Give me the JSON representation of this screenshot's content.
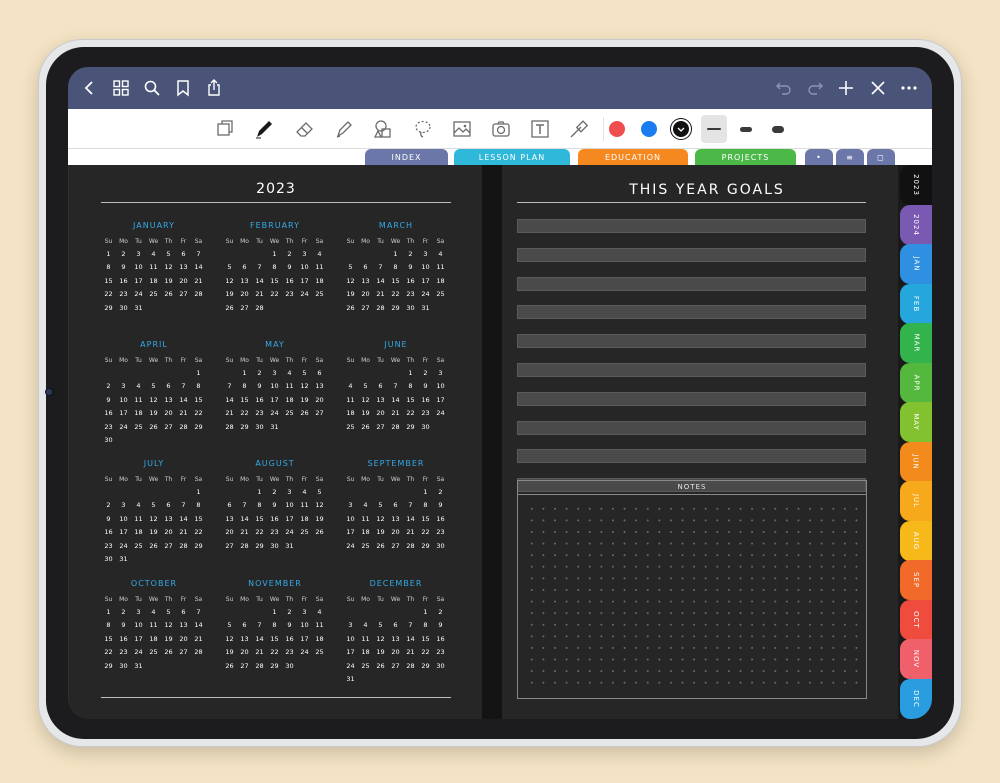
{
  "colors": {
    "background": "#f4e3c4",
    "topbar": "#4a5479",
    "page": "#262626",
    "month_accent": "#35a9e6"
  },
  "topbar": {
    "left_icons": [
      "back-chevron-icon",
      "grid-icon",
      "search-icon",
      "bookmark-icon",
      "share-icon"
    ],
    "right_icons": [
      "undo-icon",
      "redo-icon",
      "plus-icon",
      "close-icon",
      "more-icon"
    ]
  },
  "toolbar": {
    "tools": [
      "page-view-icon",
      "pen-icon",
      "eraser-icon",
      "highlighter-icon",
      "shapes-icon",
      "lasso-icon",
      "image-icon",
      "camera-icon",
      "text-icon",
      "laser-pointer-icon"
    ],
    "pen_colors": [
      "#f04e4e",
      "#1a7cf0",
      "#111111"
    ],
    "selected_color": "#111111",
    "selected_stroke": "thin"
  },
  "section_tabs": [
    {
      "label": "INDEX",
      "color": "#6a77a8"
    },
    {
      "label": "LESSON PLAN",
      "color": "#2fb8d9"
    },
    {
      "label": "EDUCATION",
      "color": "#f5891f"
    },
    {
      "label": "PROJECTS",
      "color": "#4cb848"
    }
  ],
  "mini_tabs": [
    "•",
    "≡",
    "◻"
  ],
  "left_page": {
    "year": "2023",
    "dow": [
      "Su",
      "Mo",
      "Tu",
      "We",
      "Th",
      "Fr",
      "Sa"
    ],
    "months": [
      {
        "name": "JANUARY",
        "start": 0,
        "days": 31
      },
      {
        "name": "FEBRUARY",
        "start": 3,
        "days": 28
      },
      {
        "name": "MARCH",
        "start": 3,
        "days": 31
      },
      {
        "name": "APRIL",
        "start": 6,
        "days": 30
      },
      {
        "name": "MAY",
        "start": 1,
        "days": 31
      },
      {
        "name": "JUNE",
        "start": 4,
        "days": 30
      },
      {
        "name": "JULY",
        "start": 6,
        "days": 31
      },
      {
        "name": "AUGUST",
        "start": 2,
        "days": 31
      },
      {
        "name": "SEPTEMBER",
        "start": 5,
        "days": 30
      },
      {
        "name": "OCTOBER",
        "start": 0,
        "days": 31
      },
      {
        "name": "NOVEMBER",
        "start": 3,
        "days": 30
      },
      {
        "name": "DECEMBER",
        "start": 5,
        "days": 31
      }
    ]
  },
  "right_page": {
    "title": "THIS YEAR GOALS",
    "goal_lines": 10,
    "notes_label": "NOTES"
  },
  "side_tabs": [
    {
      "label": "2023",
      "color": "#111111"
    },
    {
      "label": "2024",
      "color": "#7a59b3"
    },
    {
      "label": "JAN",
      "color": "#2f8fe0"
    },
    {
      "label": "FEB",
      "color": "#25a7de"
    },
    {
      "label": "MAR",
      "color": "#33b34b"
    },
    {
      "label": "APR",
      "color": "#55b83e"
    },
    {
      "label": "MAY",
      "color": "#82c12f"
    },
    {
      "label": "JUN",
      "color": "#f28a1c"
    },
    {
      "label": "JUL",
      "color": "#f6a91a"
    },
    {
      "label": "AUG",
      "color": "#f7b81a"
    },
    {
      "label": "SEP",
      "color": "#f26a2a"
    },
    {
      "label": "OCT",
      "color": "#ef4c3d"
    },
    {
      "label": "NOV",
      "color": "#f0606a"
    },
    {
      "label": "DEC",
      "color": "#2a9de0"
    }
  ]
}
